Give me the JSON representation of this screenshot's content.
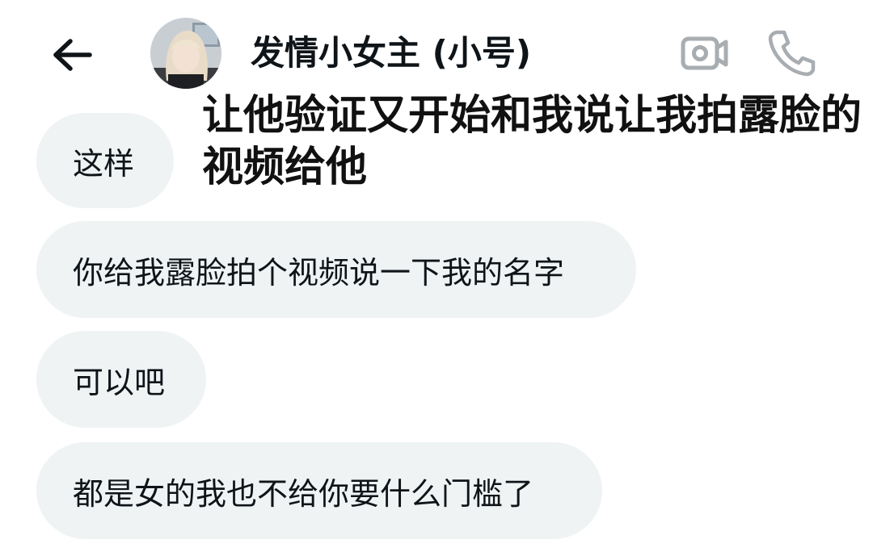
{
  "header": {
    "contact_name": "发情小女主 (小号)"
  },
  "annotation": {
    "text": "让他验证又开始和我说让我拍露脸的视频给他"
  },
  "messages": [
    {
      "text": "这样"
    },
    {
      "text": "你给我露脸拍个视频说一下我的名字"
    },
    {
      "text": "可以吧"
    },
    {
      "text": "都是女的我也不给你要什么门槛了"
    }
  ],
  "icons": {
    "back": "back-arrow-icon",
    "video": "video-camera-icon",
    "call": "phone-icon"
  },
  "colors": {
    "bubble_bg": "#eff3f4",
    "icon_gray": "#a8adb2",
    "text": "#0f1419"
  }
}
